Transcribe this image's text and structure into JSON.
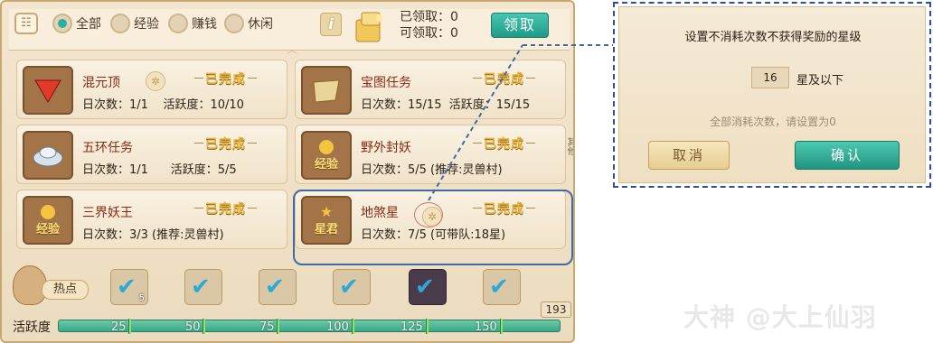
{
  "filters": [
    {
      "label": "全部",
      "selected": true
    },
    {
      "label": "经验",
      "selected": false
    },
    {
      "label": "赚钱",
      "selected": false
    },
    {
      "label": "休闲",
      "selected": false
    }
  ],
  "info_icon": "i",
  "claimed_label": "已领取：0",
  "claimable_label": "可领取：0",
  "claim_button": "领取",
  "done_label": "已完成",
  "side_label": "其他",
  "activities": [
    {
      "name": "混元顶",
      "daily": "日次数：1/1",
      "active": "活跃度：10/10",
      "icon": "red-gem-icon"
    },
    {
      "name": "宝图任务",
      "daily": "日次数：15/15",
      "active": "活跃度：15/15",
      "icon": "treasure-map-icon"
    },
    {
      "name": "五环任务",
      "daily": "日次数：1/1",
      "active": "活跃度：5/5",
      "icon": "silver-ingot-icon"
    },
    {
      "name": "野外封妖",
      "daily": "日次数：5/5 (推荐:灵兽村)",
      "active": "",
      "icon": "experience-icon",
      "icon_text": "经验"
    },
    {
      "name": "三界妖王",
      "daily": "日次数：3/3 (推荐:灵兽村)",
      "active": "",
      "icon": "experience-icon",
      "icon_text": "经验"
    },
    {
      "name": "地煞星",
      "daily": "日次数：7/5 (可带队:18星)",
      "active": "",
      "icon": "star-lord-icon",
      "icon_text": "星君"
    }
  ],
  "hot_label": "热点",
  "chests": [
    {
      "icon": "reward-chest-icon",
      "badge": "5"
    },
    {
      "icon": "reward-chest-icon",
      "badge": ""
    },
    {
      "icon": "reward-chest-icon",
      "badge": ""
    },
    {
      "icon": "reward-chest-icon",
      "badge": ""
    },
    {
      "icon": "reward-chest-icon",
      "badge": ""
    },
    {
      "icon": "reward-chest-icon",
      "badge": ""
    }
  ],
  "progress_label": "活跃度",
  "progress_total": "193",
  "milestones": [
    "25",
    "50",
    "75",
    "100",
    "125",
    "150"
  ],
  "dialog": {
    "title": "设置不消耗次数不获得奖励的星级",
    "value": "16",
    "unit": "星及以下",
    "hint": "全部消耗次数，请设置为0",
    "cancel": "取消",
    "confirm": "确认"
  },
  "watermark": "大神 @大上仙羽",
  "colors": {
    "accent": "#2bb09e",
    "done": "#e8b437",
    "highlight": "#3f6aa8",
    "name": "#8a2a14"
  }
}
